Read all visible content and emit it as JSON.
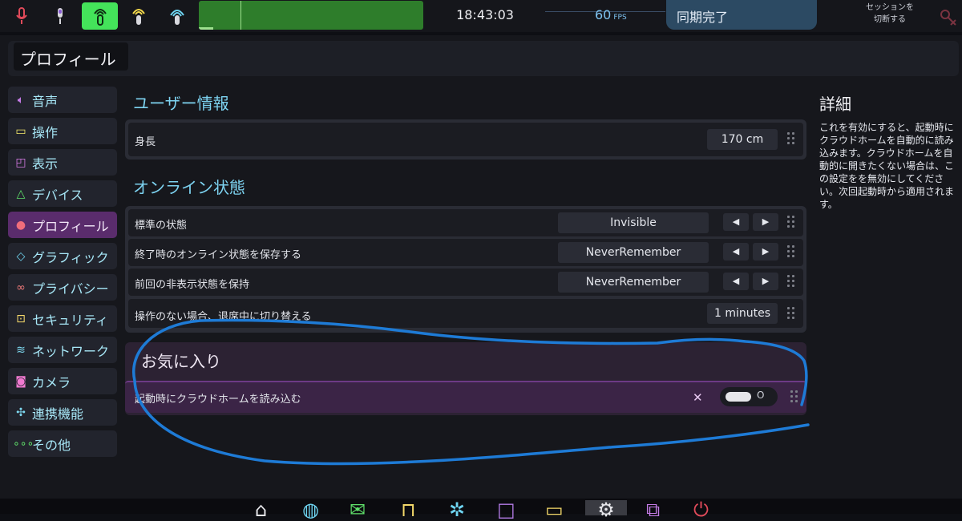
{
  "topbar": {
    "icons": [
      "mic-muted-icon",
      "mic-icon",
      "broadcast-active-icon",
      "broadcast-icon",
      "broadcast-alt-icon"
    ],
    "clock": "18:43:03",
    "fps_value": "60",
    "fps_unit": "FPS",
    "sync_status": "同期完了",
    "session_line1": "セッションを",
    "session_line2": "切断する"
  },
  "page": {
    "title": "プロフィール"
  },
  "sidebar": {
    "items": [
      {
        "label": "音声",
        "icon": "speaker-icon",
        "icon_color": "#c47be6"
      },
      {
        "label": "操作",
        "icon": "gamepad-icon",
        "icon_color": "#f3e86a"
      },
      {
        "label": "表示",
        "icon": "display-icon",
        "icon_color": "#d77be6"
      },
      {
        "label": "デバイス",
        "icon": "device-icon",
        "icon_color": "#5fe06a"
      },
      {
        "label": "プロフィール",
        "icon": "person-icon",
        "icon_color": "#f06d7b"
      },
      {
        "label": "グラフィック",
        "icon": "diamond-icon",
        "icon_color": "#6fd5f2"
      },
      {
        "label": "プライバシー",
        "icon": "glasses-icon",
        "icon_color": "#f07a7a"
      },
      {
        "label": "セキュリティ",
        "icon": "lock-icon",
        "icon_color": "#f3d86a"
      },
      {
        "label": "ネットワーク",
        "icon": "wifi-icon",
        "icon_color": "#7ed9f0"
      },
      {
        "label": "カメラ",
        "icon": "camera-icon",
        "icon_color": "#f07ad0"
      },
      {
        "label": "連携機能",
        "icon": "integration-icon",
        "icon_color": "#7ed9f0"
      },
      {
        "label": "その他",
        "icon": "more-icon",
        "icon_color": "#5fe06a"
      }
    ],
    "active_index": 4
  },
  "user_info": {
    "title": "ユーザー情報",
    "height_label": "身長",
    "height_value": "170 cm"
  },
  "online_status": {
    "title": "オンライン状態",
    "rows": [
      {
        "label": "標準の状態",
        "value": "Invisible"
      },
      {
        "label": "終了時のオンライン状態を保存する",
        "value": "NeverRemember"
      },
      {
        "label": "前回の非表示状態を保持",
        "value": "NeverRemember"
      }
    ],
    "idle_label": "操作のない場合、退席中に切り替える",
    "idle_value": "1 minutes",
    "prev_symbol": "◀",
    "next_symbol": "▶"
  },
  "favorites": {
    "title": "お気に入り",
    "row_label": "起動時にクラウドホームを読み込む",
    "toggle_state_label": "O",
    "toggle_on": false
  },
  "details": {
    "title": "詳細",
    "text": "これを有効にすると、起動時にクラウドホームを自動的に読み込みます。クラウドホームを自動的に開きたくない場合は、この設定をを無効にしてください。次回起動時から適用されます。"
  },
  "dock": {
    "icons": [
      "home-icon",
      "globe-icon",
      "mail-icon",
      "bag-icon",
      "gear-alt-icon",
      "window-icon",
      "folder-icon",
      "settings-icon",
      "inventory-icon",
      "power-icon"
    ]
  },
  "colors": {
    "accent": "#7dd3f1",
    "active_nav": "#5a2c6c",
    "sync_bg": "#2c4a63",
    "annotation": "#1e7bd6"
  }
}
